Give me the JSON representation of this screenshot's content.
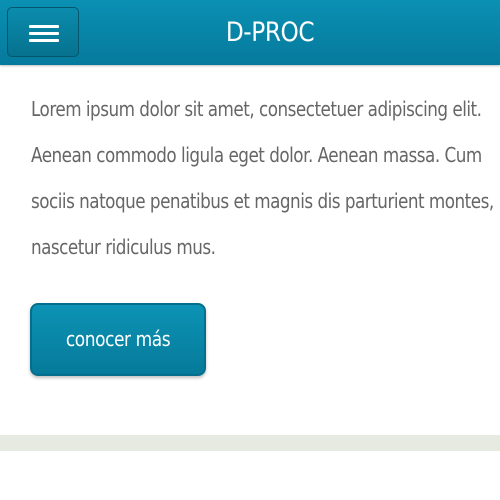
{
  "header": {
    "title": "D-PROC",
    "menu_icon": "hamburger-menu-icon"
  },
  "content": {
    "paragraph_lines": [
      "Lorem ipsum dolor sit amet, consectetuer adipiscing elit.",
      "Aenean commodo ligula eget dolor. Aenean massa. Cum",
      "sociis natoque penatibus et magnis dis parturient montes,",
      "nascetur ridiculus mus."
    ],
    "cta_label": "conocer más"
  },
  "colors": {
    "header_background": "#0887aa",
    "text": "#666666",
    "button_background": "#0a88a9",
    "footer_band": "#e6eae1"
  }
}
